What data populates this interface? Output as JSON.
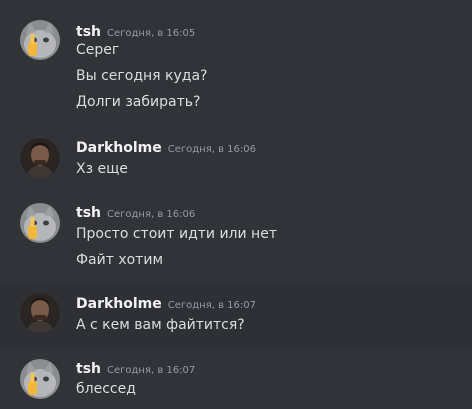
{
  "messages": [
    {
      "author": "tsh",
      "timestamp": "Сегодня, в 16:05",
      "avatar": "cat-middle-finger-avatar",
      "lines": [
        "Серег",
        "Вы сегодня куда?",
        "Долги забирать?"
      ]
    },
    {
      "author": "Darkholme",
      "timestamp": "Сегодня, в 16:06",
      "avatar": "man-portrait-avatar",
      "lines": [
        "Хз еще"
      ]
    },
    {
      "author": "tsh",
      "timestamp": "Сегодня, в 16:06",
      "avatar": "cat-middle-finger-avatar",
      "lines": [
        "Просто стоит идти или нет",
        "Файт хотим"
      ]
    },
    {
      "author": "Darkholme",
      "timestamp": "Сегодня, в 16:07",
      "avatar": "man-portrait-avatar",
      "lines": [
        "А с кем вам файтится?"
      ]
    },
    {
      "author": "tsh",
      "timestamp": "Сегодня, в 16:07",
      "avatar": "cat-middle-finger-avatar",
      "lines": [
        "блессед"
      ]
    }
  ],
  "colors": {
    "background": "#313338",
    "username": "#f2f3f5",
    "timestamp": "#949ba4",
    "message_text": "#dbdee1"
  }
}
